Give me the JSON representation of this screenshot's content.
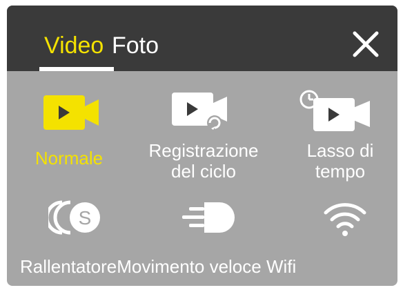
{
  "colors": {
    "accent": "#f4e200",
    "header_bg": "#3a3a3a",
    "panel_bg": "#a6a6a6",
    "text": "#ffffff"
  },
  "tabs": [
    {
      "label": "Video",
      "selected": true
    },
    {
      "label": "Foto",
      "selected": false
    }
  ],
  "close_icon": "close-icon",
  "modes": [
    {
      "icon": "video-camera-icon",
      "lines": [
        "Normale"
      ],
      "selected": true
    },
    {
      "icon": "loop-recording-icon",
      "lines": [
        "Registrazione",
        "del ciclo"
      ],
      "selected": false
    },
    {
      "icon": "time-lapse-icon",
      "lines": [
        "Lasso di",
        "tempo"
      ],
      "selected": false
    },
    {
      "icon": "slow-motion-icon",
      "selected": false
    },
    {
      "icon": "fast-motion-icon",
      "selected": false
    },
    {
      "icon": "wifi-icon",
      "selected": false
    }
  ],
  "bottom_row_text": "RallentatoreMovimento veloce Wifi"
}
